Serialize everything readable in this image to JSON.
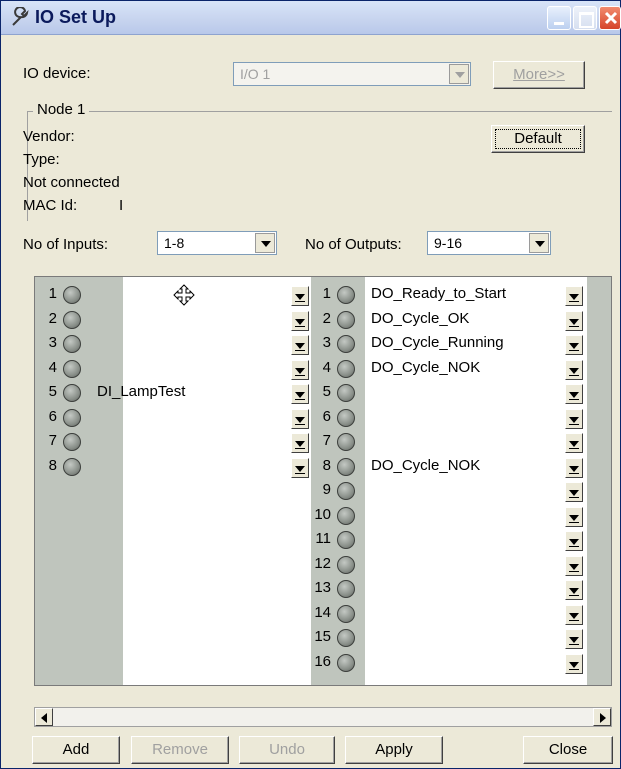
{
  "window": {
    "title": "IO Set Up",
    "icon": "wrench-icon"
  },
  "io_device": {
    "label": "IO device:",
    "value": "I/O 1",
    "more_label": "More>>"
  },
  "node": {
    "group_label": "Node 1",
    "vendor_label": "Vendor:",
    "type_label": "Type:",
    "status": "Not connected",
    "mac_label": "MAC Id:",
    "mac_value": "I",
    "default_label": "Default"
  },
  "inputs": {
    "label": "No of Inputs:",
    "value": "1-8"
  },
  "outputs": {
    "label": "No of Outputs:",
    "value": "9-16"
  },
  "input_rows": [
    {
      "num": "1",
      "name": ""
    },
    {
      "num": "2",
      "name": ""
    },
    {
      "num": "3",
      "name": ""
    },
    {
      "num": "4",
      "name": ""
    },
    {
      "num": "5",
      "name": "DI_LampTest"
    },
    {
      "num": "6",
      "name": ""
    },
    {
      "num": "7",
      "name": ""
    },
    {
      "num": "8",
      "name": ""
    }
  ],
  "output_rows": [
    {
      "num": "1",
      "name": "DO_Ready_to_Start"
    },
    {
      "num": "2",
      "name": "DO_Cycle_OK"
    },
    {
      "num": "3",
      "name": "DO_Cycle_Running"
    },
    {
      "num": "4",
      "name": "DO_Cycle_NOK"
    },
    {
      "num": "5",
      "name": ""
    },
    {
      "num": "6",
      "name": ""
    },
    {
      "num": "7",
      "name": ""
    },
    {
      "num": "8",
      "name": "DO_Cycle_NOK"
    },
    {
      "num": "9",
      "name": ""
    },
    {
      "num": "10",
      "name": ""
    },
    {
      "num": "11",
      "name": ""
    },
    {
      "num": "12",
      "name": ""
    },
    {
      "num": "13",
      "name": ""
    },
    {
      "num": "14",
      "name": ""
    },
    {
      "num": "15",
      "name": ""
    },
    {
      "num": "16",
      "name": ""
    }
  ],
  "buttons": {
    "add": "Add",
    "remove": "Remove",
    "undo": "Undo",
    "apply": "Apply",
    "close": "Close"
  }
}
